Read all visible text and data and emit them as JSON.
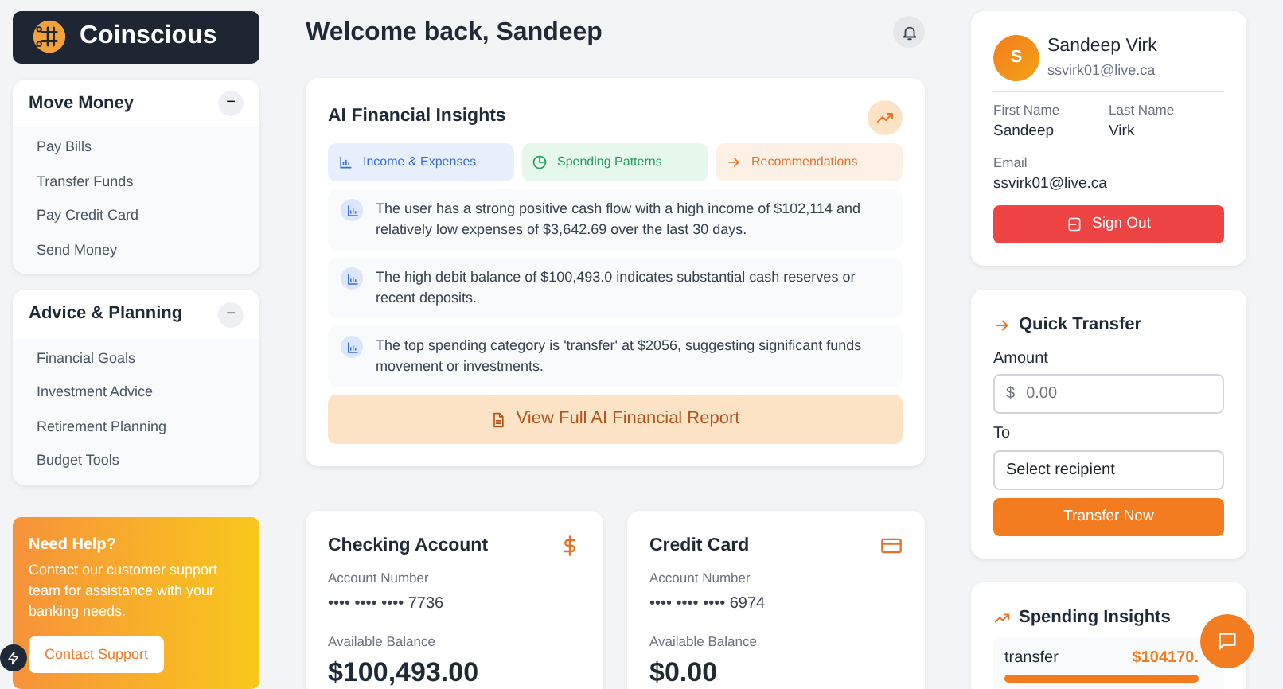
{
  "brand": {
    "name": "Coinscious"
  },
  "sidebar": {
    "sections": [
      {
        "title": "Move Money",
        "expanded": true,
        "toggle": "−",
        "items": [
          "Pay Bills",
          "Transfer Funds",
          "Pay Credit Card",
          "Send Money"
        ]
      },
      {
        "title": "Advice & Planning",
        "expanded": true,
        "toggle": "−",
        "items": [
          "Financial Goals",
          "Investment Advice",
          "Retirement Planning",
          "Budget Tools"
        ]
      }
    ],
    "help": {
      "title": "Need Help?",
      "text": "Contact our customer support team for assistance with your banking needs.",
      "button": "Contact Support"
    }
  },
  "header": {
    "greeting": "Welcome back, Sandeep"
  },
  "insights": {
    "title": "AI Financial Insights",
    "tabs": [
      {
        "label": "Income & Expenses",
        "kind": "bars",
        "color": "#3b6fd8"
      },
      {
        "label": "Spending Patterns",
        "kind": "pie",
        "color": "#22a05a"
      },
      {
        "label": "Recommendations",
        "kind": "arrow",
        "color": "#e8712a"
      }
    ],
    "items": [
      "The user has a strong positive cash flow with a high income of $102,114 and relatively low expenses of $3,642.69 over the last 30 days.",
      "The high debit balance of $100,493.0 indicates substantial cash reserves or recent deposits.",
      "The top spending category is 'transfer' at $2056, suggesting significant funds movement or investments."
    ],
    "report_button": "View Full AI Financial Report"
  },
  "accounts": [
    {
      "title": "Checking Account",
      "kind": "dollar",
      "number_label": "Account Number",
      "number": "•••• •••• •••• 7736",
      "balance_label": "Available Balance",
      "balance": "$100,493.00"
    },
    {
      "title": "Credit Card",
      "kind": "card",
      "number_label": "Account Number",
      "number": "•••• •••• •••• 6974",
      "balance_label": "Available Balance",
      "balance": "$0.00"
    }
  ],
  "profile": {
    "initial": "S",
    "name": "Sandeep Virk",
    "email": "ssvirk01@live.ca",
    "fields": [
      {
        "label": "First Name",
        "value": "Sandeep"
      },
      {
        "label": "Last Name",
        "value": "Virk"
      },
      {
        "label": "Email",
        "value": "ssvirk01@live.ca"
      }
    ],
    "sign_out": "Sign Out"
  },
  "quick_transfer": {
    "title": "Quick Transfer",
    "amount_label": "Amount",
    "currency": "$",
    "placeholder": "0.00",
    "to_label": "To",
    "recipient": "Select recipient",
    "button": "Transfer Now"
  },
  "spending_insights": {
    "title": "Spending Insights",
    "items": [
      {
        "category": "transfer",
        "amount": "$104170.",
        "level": 1
      }
    ]
  }
}
